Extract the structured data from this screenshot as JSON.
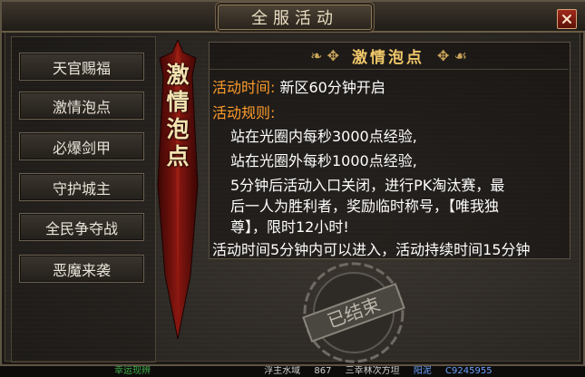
{
  "window": {
    "title": "全服活动"
  },
  "menu": [
    {
      "label": "天官赐福"
    },
    {
      "label": "激情泡点"
    },
    {
      "label": "必爆剑甲"
    },
    {
      "label": "守护城主"
    },
    {
      "label": "全民争夺战"
    },
    {
      "label": "恶魔来袭"
    }
  ],
  "banner": {
    "chars": [
      "激",
      "情",
      "泡",
      "点"
    ]
  },
  "activity": {
    "title": "激情泡点",
    "time_label": "活动时间:",
    "time_value": "新区60分钟开启",
    "rules_label": "活动规则:",
    "rules": [
      "站在光圈内每秒3000点经验,",
      "站在光圈外每秒1000点经验,",
      "5分钟后活动入口关闭，进行PK淘汰赛，最",
      "后一人为胜利者，奖励临时称号，【唯我独",
      "尊】，限时12小时!"
    ],
    "footer": "活动时间5分钟内可以进入，活动持续时间15分钟"
  },
  "stamp": {
    "text": "已结束"
  },
  "bottom_bar": {
    "items": [
      "幸运现辨",
      "浮主水域",
      "867",
      "三幸林次方坦",
      "阳泥",
      "C9245955"
    ]
  },
  "colors": {
    "accent": "#f2c86a",
    "label": "#ff9c2a",
    "text": "#ffffff",
    "close": "#a02a1a"
  }
}
